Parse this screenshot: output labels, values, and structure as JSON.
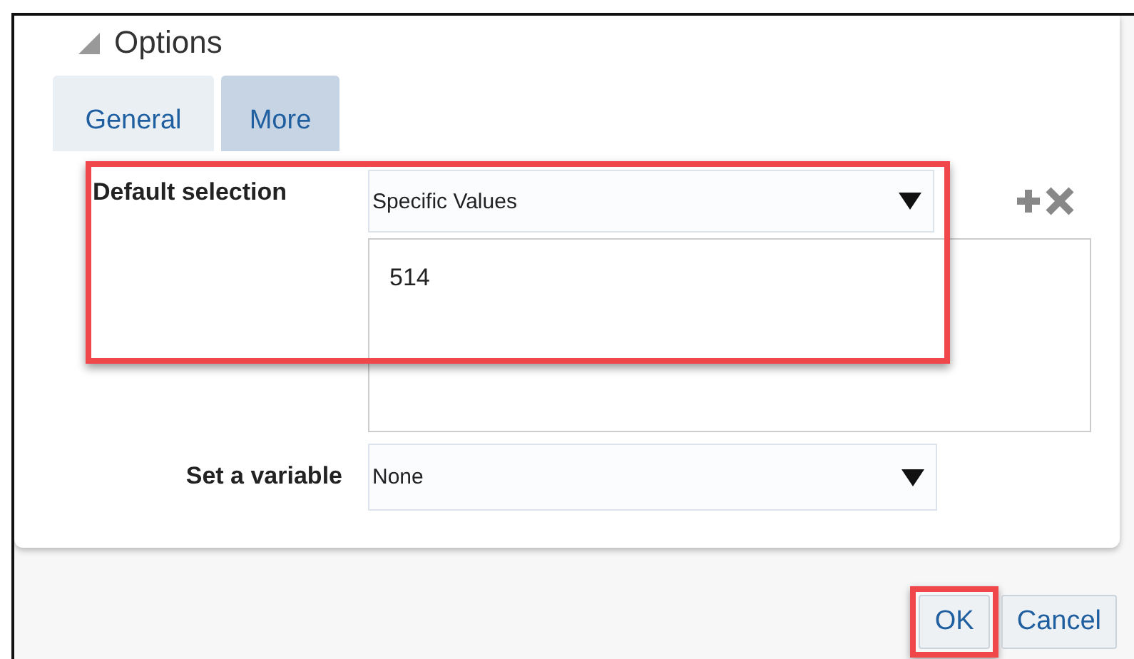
{
  "section": {
    "title": "Options",
    "expanded": true
  },
  "tabs": [
    {
      "label": "General",
      "selected": false
    },
    {
      "label": "More",
      "selected": true
    }
  ],
  "default_selection": {
    "label": "Default selection",
    "dropdown": "Specific Values",
    "values": "514",
    "highlighted": true
  },
  "variable": {
    "label": "Set a variable",
    "dropdown": "None"
  },
  "buttons": [
    {
      "label": "OK",
      "highlighted": true
    },
    {
      "label": "Cancel",
      "highlighted": false
    }
  ]
}
